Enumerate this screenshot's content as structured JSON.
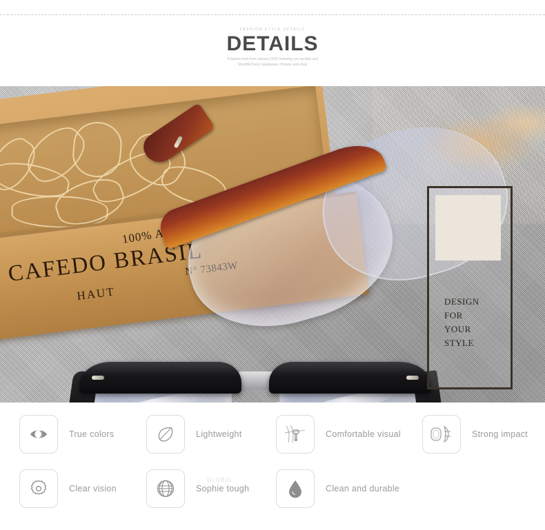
{
  "header": {
    "kicker": "FASHION  STYLE  DETAILS",
    "title": "DETAILS",
    "subtitle": "A fashion look from January 2015 featuring rye sandals and Sheriff&Cherry sunglasses. Browse and shop"
  },
  "colors": {
    "accent_yellow": "#f5d917",
    "bar_dark": "#333333",
    "title_gray": "#4a4a4a",
    "label_gray": "#9a9a9a",
    "icon_border": "#dcdcdc",
    "card_border": "#3a3229",
    "swatch": "#ece5dc"
  },
  "hero": {
    "crate_text": {
      "arabica": "100% ARABICA",
      "brasil": "CAFEDO BRASIL",
      "number": "N° 73843W",
      "haut": "HAUT"
    },
    "design_card": {
      "lines": [
        "DESIGN",
        "FOR",
        "YOUR",
        "STYLE"
      ]
    }
  },
  "features": {
    "row1": [
      {
        "icon": "eye-icon",
        "label": "True colors"
      },
      {
        "icon": "leaf-icon",
        "label": "Lightweight"
      },
      {
        "icon": "hinge-screw-icon",
        "label": "Comfortable visual"
      },
      {
        "icon": "lens-temple-icon",
        "label": "Strong impact"
      }
    ],
    "row2": [
      {
        "icon": "gear-icon",
        "label": "Clear vision"
      },
      {
        "icon": "globe-icon",
        "label": "Sophie tough",
        "ghost": "GLOBAL"
      },
      {
        "icon": "droplet-icon",
        "label": "Clean and durable"
      }
    ]
  }
}
